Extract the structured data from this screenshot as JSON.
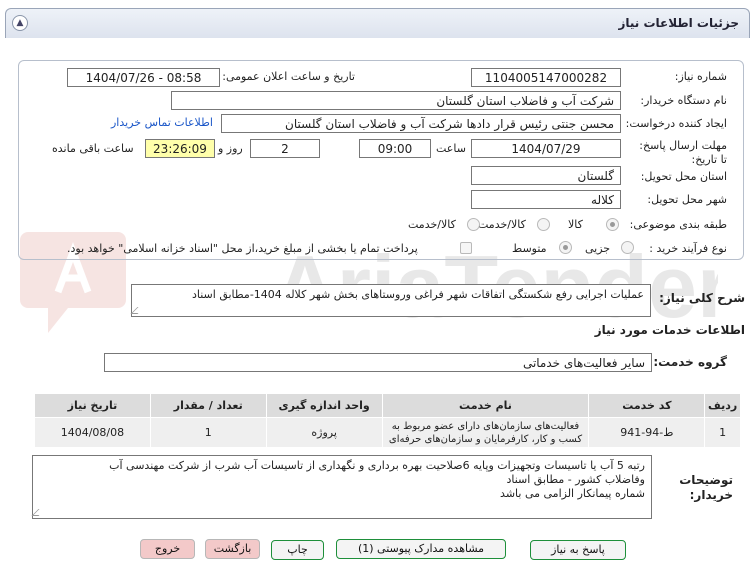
{
  "panel": {
    "title": "جزئیات اطلاعات نیاز"
  },
  "info": {
    "need_number_label": "شماره نیاز:",
    "need_number": "1104005147000282",
    "announce_label": "تاریخ و ساعت اعلان عمومی:",
    "announce_value": "1404/07/26 - 08:58",
    "buyer_org_label": "نام دستگاه خریدار:",
    "buyer_org": "شرکت آب و فاضلاب استان گلستان",
    "creator_label": "ایجاد کننده درخواست:",
    "creator": "محسن جنتی رئیس قرار دادها شرکت آب و فاضلاب استان گلستان",
    "contact_link": "اطلاعات تماس خریدار",
    "deadline_label": "مهلت ارسال پاسخ: تا تاریخ:",
    "deadline_date": "1404/07/29",
    "time_label": "ساعت",
    "deadline_time": "09:00",
    "days_value": "2",
    "days_label": "روز و",
    "remaining_time": "23:26:09",
    "remaining_label": "ساعت باقی مانده",
    "province_label": "استان محل تحویل:",
    "province": "گلستان",
    "city_label": "شهر محل تحویل:",
    "city": "کلاله",
    "category_label": "طبقه بندی موضوعی:",
    "category_options": [
      "کالا",
      "کالا/خدمت"
    ],
    "purchase_type_label": "نوع فرآیند خرید :",
    "purchase_options": [
      "جزیی",
      "متوسط"
    ],
    "treasury_note": "پرداخت تمام یا بخشی از مبلغ خرید،از محل \"اسناد خزانه اسلامی\" خواهد بود."
  },
  "description": {
    "label": "شرح کلی نیاز:",
    "text": "عملیات اجرایی رفع شکستگی اتفاقات شهر فراغی وروستاهای بخش شهر کلاله 1404-مطابق اسناد"
  },
  "services": {
    "section_title": "اطلاعات خدمات مورد نیاز",
    "group_label": "گروه خدمت:",
    "group_value": "سایر فعالیت‌های خدماتی",
    "columns": [
      "ردیف",
      "کد خدمت",
      "نام خدمت",
      "واحد اندازه گیری",
      "تعداد / مقدار",
      "تاریخ نیاز"
    ],
    "rows": [
      [
        "1",
        "ط-94-941",
        "فعالیت‌های سازمان‌های دارای عضو مربوط به کسب و کار، کارفرمایان و سازمان‌های حرفه‌ای",
        "پروژه",
        "1",
        "1404/08/08"
      ]
    ]
  },
  "buyer_notes": {
    "label": "توضیحات خریدار:",
    "lines": [
      "رتبه 5 آب یا تاسیسات وتجهیزات وپایه 6صلاحیت بهره برداری و نگهداری از تاسیسات آب شرب از شرکت مهندسی آب",
      "وفاضلاب کشور - مطابق اسناد",
      "شماره پیمانکار الزامی می باشد"
    ]
  },
  "buttons": {
    "reply": "پاسخ به نیاز",
    "attachments": "مشاهده مدارک پیوستی (1)",
    "print": "چاپ",
    "back": "بازگشت",
    "exit": "خروج"
  },
  "watermark": {
    "text": "AriaTender.net",
    "color": "#c0392b"
  }
}
